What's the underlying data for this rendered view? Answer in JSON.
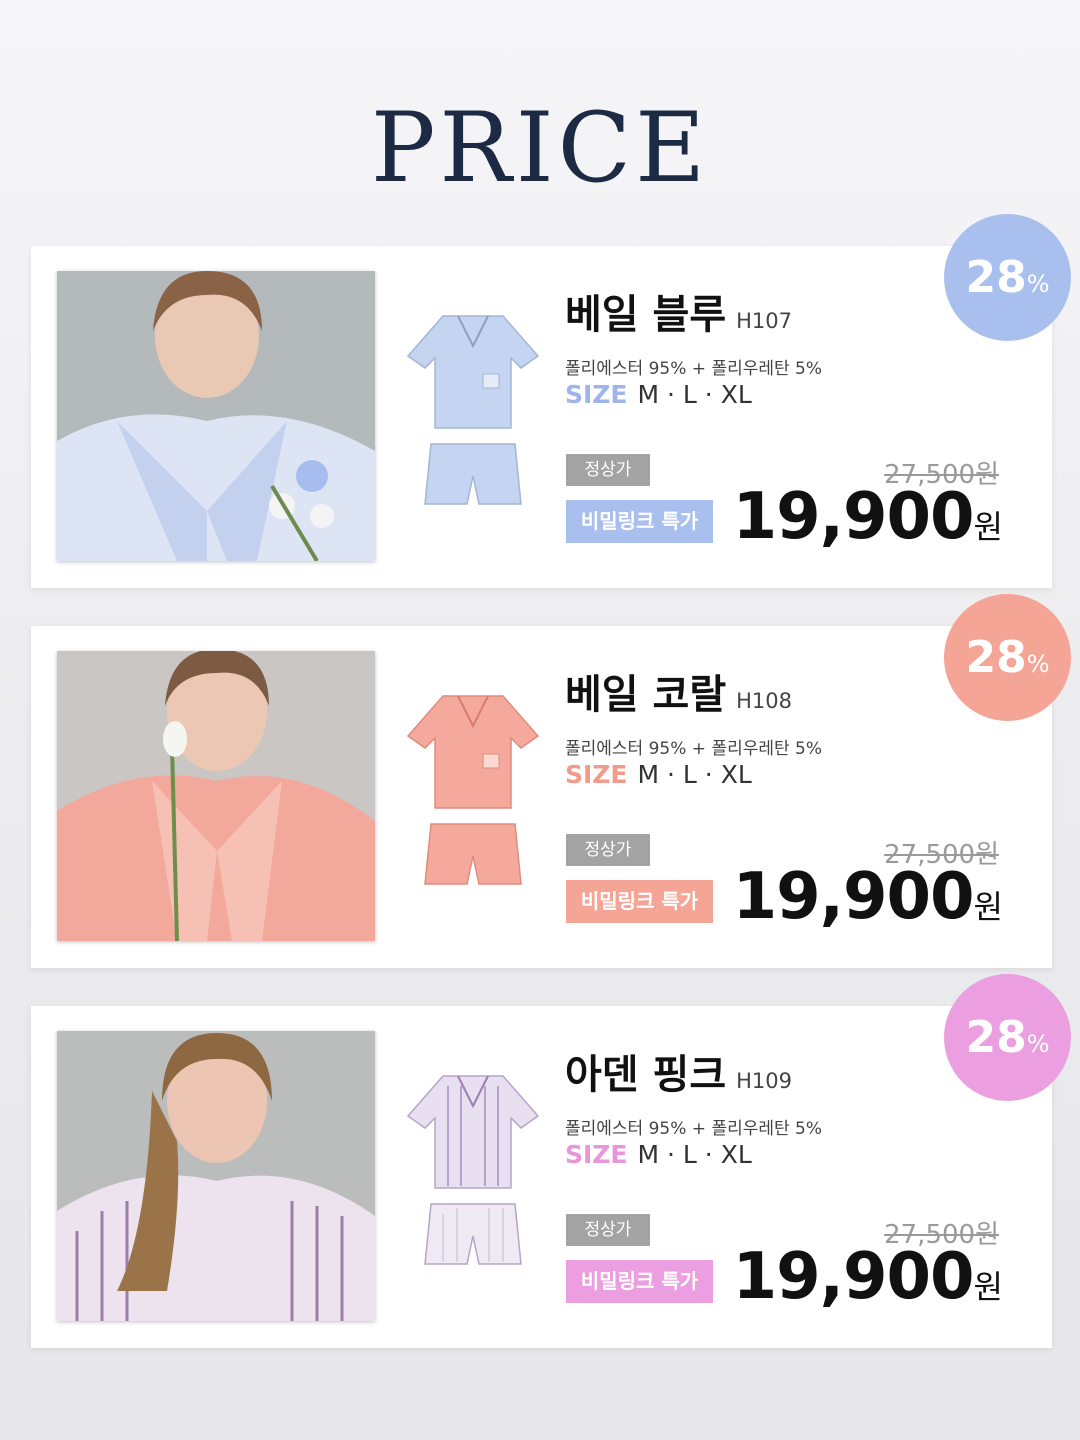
{
  "title": "PRICE",
  "colors": {
    "blue": "#a9c0ef",
    "coral": "#f5a596",
    "pink": "#ec9fe0"
  },
  "products": [
    {
      "name": "베일 블루",
      "code": "H107",
      "material": "폴리에스터 95% + 폴리우레탄 5%",
      "size_label": "SIZE",
      "sizes": "M · L · XL",
      "regular_label": "정상가",
      "special_label": "비밀링크 특가",
      "original_price": "27,500원",
      "sale_price": "19,900",
      "currency": "원",
      "discount": "28",
      "discount_unit": "%",
      "accent": "blue"
    },
    {
      "name": "베일 코랄",
      "code": "H108",
      "material": "폴리에스터 95% + 폴리우레탄 5%",
      "size_label": "SIZE",
      "sizes": "M · L · XL",
      "regular_label": "정상가",
      "special_label": "비밀링크 특가",
      "original_price": "27,500원",
      "sale_price": "19,900",
      "currency": "원",
      "discount": "28",
      "discount_unit": "%",
      "accent": "coral"
    },
    {
      "name": "아덴 핑크",
      "code": "H109",
      "material": "폴리에스터 95% + 폴리우레탄 5%",
      "size_label": "SIZE",
      "sizes": "M · L · XL",
      "regular_label": "정상가",
      "special_label": "비밀링크 특가",
      "original_price": "27,500원",
      "sale_price": "19,900",
      "currency": "원",
      "discount": "28",
      "discount_unit": "%",
      "accent": "pink"
    }
  ]
}
